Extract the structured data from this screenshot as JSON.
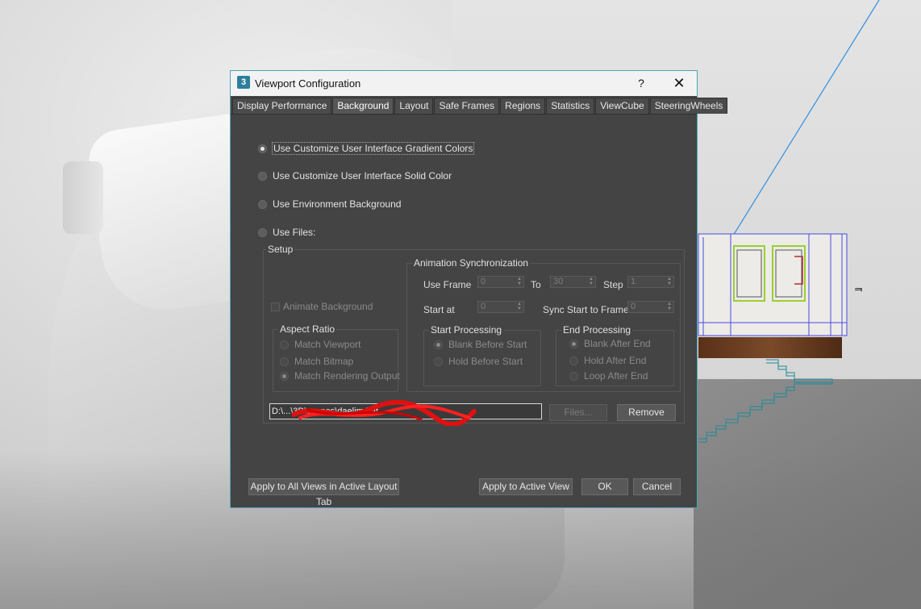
{
  "dialog": {
    "title": "Viewport Configuration",
    "help_label": "?",
    "close_label": "✕",
    "app_icon_label": "3"
  },
  "tabs": [
    {
      "label": "Display Performance"
    },
    {
      "label": "Background",
      "active": true
    },
    {
      "label": "Layout"
    },
    {
      "label": "Safe Frames"
    },
    {
      "label": "Regions"
    },
    {
      "label": "Statistics"
    },
    {
      "label": "ViewCube"
    },
    {
      "label": "SteeringWheels"
    }
  ],
  "background_options": {
    "gradient": "Use Customize User Interface Gradient Colors",
    "solid": "Use Customize User Interface Solid Color",
    "environment": "Use Environment Background",
    "files": "Use Files:",
    "selected": "gradient"
  },
  "setup": {
    "title": "Setup",
    "animate_background": "Animate Background",
    "aspect_ratio": {
      "title": "Aspect Ratio",
      "options": [
        "Match Viewport",
        "Match Bitmap",
        "Match Rendering Output"
      ],
      "selected": "Match Rendering Output"
    },
    "animation_sync": {
      "title": "Animation Synchronization",
      "use_frame_label": "Use Frame",
      "use_frame_value": "0",
      "to_label": "To",
      "to_value": "30",
      "step_label": "Step",
      "step_value": "1",
      "start_at_label": "Start at",
      "start_at_value": "0",
      "sync_start_label": "Sync Start to Frame",
      "sync_start_value": "0"
    },
    "start_processing": {
      "title": "Start Processing",
      "options": [
        "Blank Before Start",
        "Hold Before Start"
      ],
      "selected": "Blank Before Start"
    },
    "end_processing": {
      "title": "End Processing",
      "options": [
        "Blank After End",
        "Hold After End",
        "Loop After End"
      ],
      "selected": "Blank After End"
    },
    "file_path": "D:\\...\\3D\\scenes\\daelim bat",
    "files_button": "Files...",
    "remove_button": "Remove"
  },
  "footer": {
    "apply_all": "Apply to All Views in Active Layout Tab",
    "apply_active": "Apply to Active View",
    "ok": "OK",
    "cancel": "Cancel"
  },
  "viewport": {
    "glyph": "ᆿ"
  },
  "colors": {
    "dialog_bg": "#444444",
    "accent_border": "#4fa4b8",
    "scene_line": "#2f8fe0",
    "wireframe": "#4a4ae0",
    "selection": "#9ad030"
  }
}
